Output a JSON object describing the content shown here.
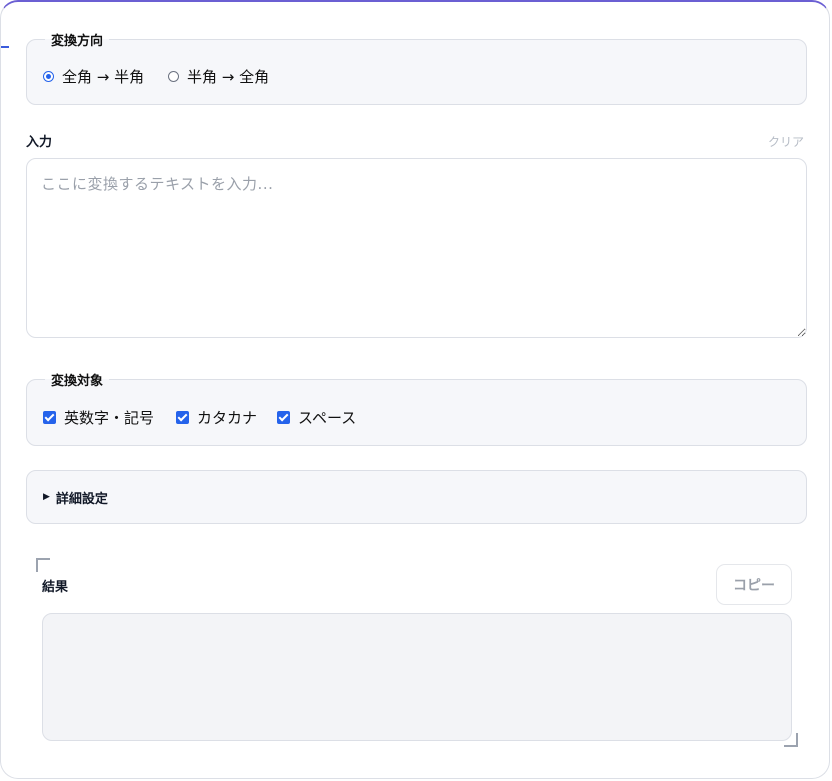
{
  "direction": {
    "legend": "変換方向",
    "options": [
      {
        "label": "全角 → 半角",
        "selected": true
      },
      {
        "label": "半角 → 全角",
        "selected": false
      }
    ]
  },
  "input": {
    "label": "入力",
    "clear_label": "クリア",
    "placeholder": "ここに変換するテキストを入力...",
    "value": ""
  },
  "targets": {
    "legend": "変換対象",
    "options": [
      {
        "label": "英数字・記号",
        "checked": true
      },
      {
        "label": "カタカナ",
        "checked": true
      },
      {
        "label": "スペース",
        "checked": true
      }
    ]
  },
  "advanced": {
    "label": "詳細設定"
  },
  "result": {
    "label": "結果",
    "copy_label": "コピー",
    "value": ""
  },
  "colors": {
    "accent": "#2563eb",
    "frame_top": "#6b5fd3"
  }
}
